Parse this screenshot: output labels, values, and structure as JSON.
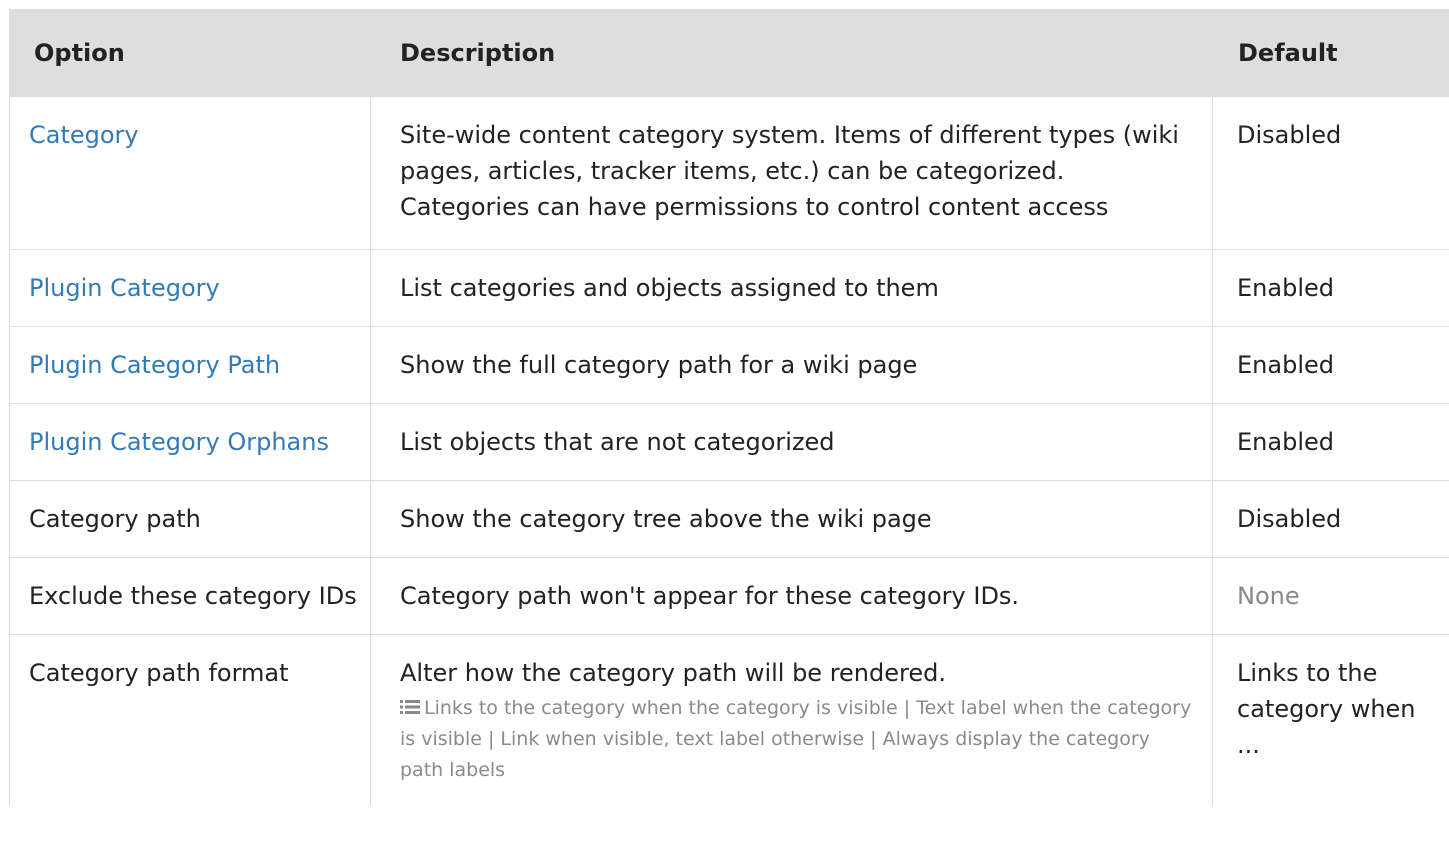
{
  "table": {
    "headers": {
      "option": "Option",
      "description": "Description",
      "default": "Default"
    },
    "rows": [
      {
        "option": "Category",
        "option_is_link": true,
        "description": "Site-wide content category system. Items of different types (wiki pages, articles, tracker items, etc.) can be categorized. Categories can have permissions to control content access",
        "default": "Disabled"
      },
      {
        "option": "Plugin Category",
        "option_is_link": true,
        "description": "List categories and objects assigned to them",
        "default": "Enabled"
      },
      {
        "option": "Plugin Category Path",
        "option_is_link": true,
        "description": "Show the full category path for a wiki page",
        "default": "Enabled"
      },
      {
        "option": "Plugin Category Orphans",
        "option_is_link": true,
        "description": "List objects that are not categorized",
        "default": "Enabled"
      },
      {
        "option": "Category path",
        "option_is_link": false,
        "description": "Show the category tree above the wiki page",
        "default": "Disabled"
      },
      {
        "option": "Exclude these category IDs",
        "option_is_link": false,
        "description": "Category path won't appear for these category IDs.",
        "default": "None",
        "default_muted": true
      },
      {
        "option": "Category path format",
        "option_is_link": false,
        "description": "Alter how the category path will be rendered.",
        "choices_icon": "list-icon",
        "choices": "Links to the category when the category is visible | Text label when the category is visible | Link when visible, text label otherwise | Always display the category path labels",
        "default": "Links to the category when ..."
      }
    ]
  },
  "colors": {
    "header_bg": "#dedede",
    "link": "#337ab7",
    "muted": "#888888",
    "border": "#dddddd"
  }
}
